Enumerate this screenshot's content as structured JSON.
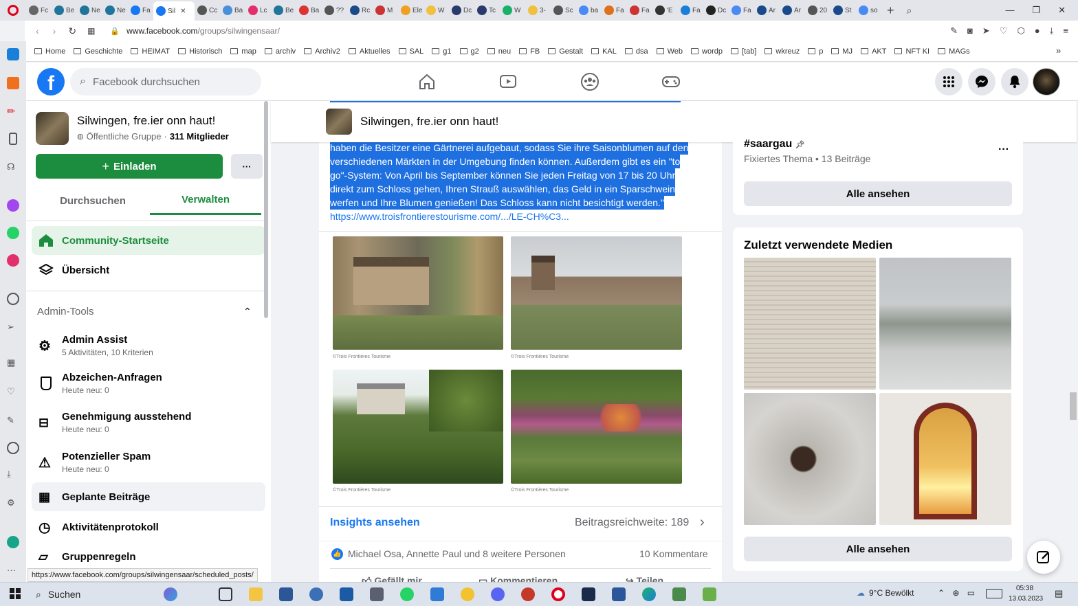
{
  "browser": {
    "tabs": [
      {
        "label": "Fc"
      },
      {
        "label": "Be"
      },
      {
        "label": "Ne"
      },
      {
        "label": "Ne"
      },
      {
        "label": "Fa"
      },
      {
        "label": "Sil"
      },
      {
        "label": "Cc"
      },
      {
        "label": "Ba"
      },
      {
        "label": "Lc"
      },
      {
        "label": "Be"
      },
      {
        "label": "Ba"
      },
      {
        "label": "??"
      },
      {
        "label": "Rc"
      },
      {
        "label": "M"
      },
      {
        "label": "Ele"
      },
      {
        "label": "W"
      },
      {
        "label": "Dc"
      },
      {
        "label": "Tc"
      },
      {
        "label": "W"
      },
      {
        "label": "3-"
      },
      {
        "label": "Sc"
      },
      {
        "label": "ba"
      },
      {
        "label": "Fa"
      },
      {
        "label": "Fa"
      },
      {
        "label": "'E"
      },
      {
        "label": "Fa"
      },
      {
        "label": "Dc"
      },
      {
        "label": "Fa"
      },
      {
        "label": "Ar"
      },
      {
        "label": "Ar"
      },
      {
        "label": "20"
      },
      {
        "label": "St"
      },
      {
        "label": "so"
      }
    ],
    "url_host": "www.facebook.com",
    "url_path": "/groups/silwingensaar/",
    "bookmarks": [
      "Home",
      "Geschichte",
      "HEIMAT",
      "Historisch",
      "map",
      "archiv",
      "Archiv2",
      "Aktuelles",
      "SAL",
      "g1",
      "g2",
      "neu",
      "FB",
      "Gestalt",
      "KAL",
      "dsa",
      "Web",
      "wordp",
      "[tab]",
      "wkreuz",
      "p",
      "MJ",
      "AKT",
      "NFT KI",
      "MAGs"
    ],
    "status_url": "https://www.facebook.com/groups/silwingensaar/scheduled_posts/"
  },
  "fb": {
    "search_placeholder": "Facebook durchsuchen"
  },
  "group": {
    "name": "Silwingen, fre.ier onn haut!",
    "privacy": "Öffentliche Gruppe",
    "members": "311 Mitglieder",
    "invite_label": "Einladen",
    "more_label": "···",
    "tab_search": "Durchsuchen",
    "tab_manage": "Verwalten"
  },
  "left_menu": {
    "community": "Community-Startseite",
    "overview": "Übersicht",
    "admin_tools": "Admin-Tools",
    "items": [
      {
        "label": "Admin Assist",
        "sub": "5 Aktivitäten, 10 Kriterien"
      },
      {
        "label": "Abzeichen-Anfragen",
        "sub": "Heute neu: 0"
      },
      {
        "label": "Genehmigung ausstehend",
        "sub": "Heute neu: 0"
      },
      {
        "label": "Potenzieller Spam",
        "sub": "Heute neu: 0"
      },
      {
        "label": "Geplante Beiträge",
        "sub": ""
      },
      {
        "label": "Aktivitätenprotokoll",
        "sub": ""
      },
      {
        "label": "Gruppenregeln",
        "sub": ""
      }
    ]
  },
  "post": {
    "text_lines": [
      "haben die Besitzer eine Gärtnerei aufgebaut, sodass Sie ihre Saisonblumen auf den",
      "verschiedenen Märkten in der Umgebung finden können. Außerdem gibt es ein \"to",
      "go\"-System: Von April bis September können Sie jeden Freitag von 17 bis 20 Uhr",
      "direkt zum Schloss gehen, Ihren Strauß auswählen, das Geld in ein Sparschwein",
      "werfen und Ihre Blumen genießen! Das Schloss kann nicht besichtigt werden.\""
    ],
    "link": "https://www.troisfrontierestourisme.com/.../LE-CH%C3...",
    "photo_credit": "©Trois Frontières Tourisme",
    "insights": "Insights ansehen",
    "reach": "Beitragsreichweite: 189",
    "reactions": "Michael Osa, Annette Paul und 8 weitere Personen",
    "comments": "10 Kommentare",
    "like": "Gefällt mir",
    "comment": "Kommentieren",
    "share": "Teilen"
  },
  "right": {
    "topic_tag": "#saargau",
    "topic_meta": "Fixiertes Thema • 13 Beiträge",
    "see_all": "Alle ansehen",
    "media_title": "Zuletzt verwendete Medien",
    "see_all_media": "Alle ansehen"
  },
  "taskbar": {
    "search": "Suchen",
    "weather": "9°C  Bewölkt",
    "time": "05:38",
    "date": "13.03.2023"
  },
  "colors": {
    "fb_blue": "#1877f2",
    "green": "#1c8d3e",
    "selection": "#1e6fe0"
  }
}
